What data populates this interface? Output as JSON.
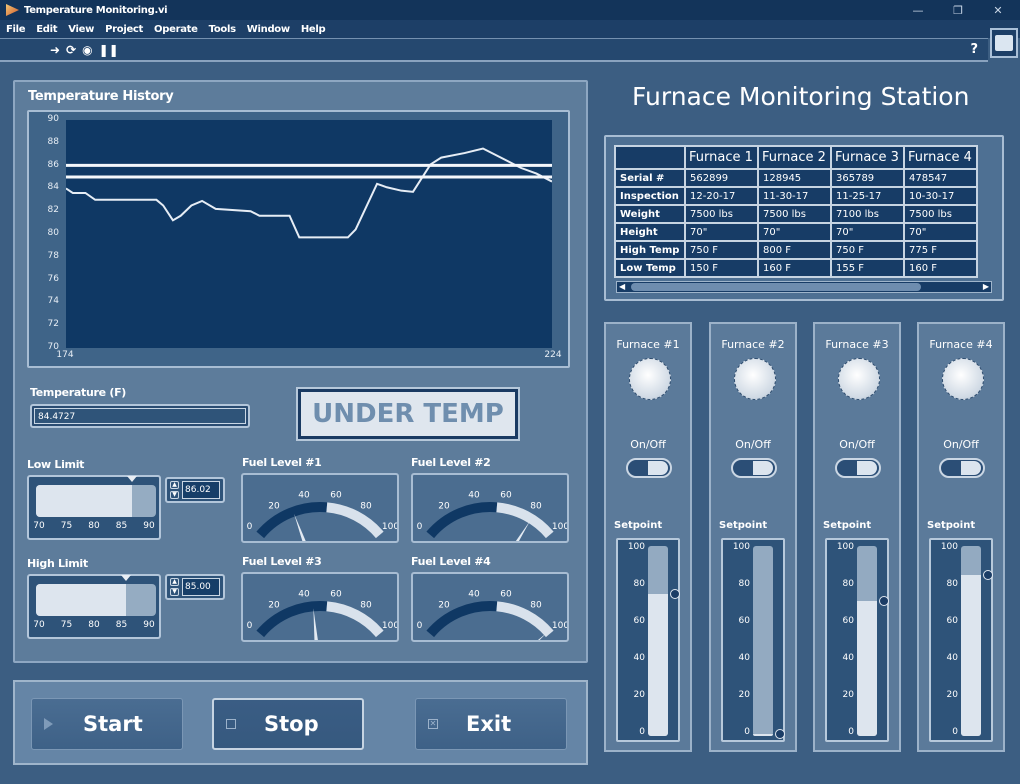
{
  "window": {
    "title": "Temperature Monitoring.vi",
    "controls": [
      "minimize",
      "restore",
      "close"
    ]
  },
  "menu": [
    "File",
    "Edit",
    "View",
    "Project",
    "Operate",
    "Tools",
    "Window",
    "Help"
  ],
  "toolbar": {
    "icons": [
      "run-arrow-icon",
      "run-continuous-icon",
      "abort-icon",
      "pause-icon"
    ],
    "help": "?"
  },
  "graph": {
    "title": "Temperature History"
  },
  "chart_data": {
    "type": "line",
    "title": "Temperature History",
    "xlim": [
      174,
      224
    ],
    "ylim": [
      70,
      90
    ],
    "x_ticks": [
      "174",
      "224"
    ],
    "y_ticks": [
      "70",
      "72",
      "74",
      "76",
      "78",
      "80",
      "82",
      "84",
      "86",
      "88",
      "90"
    ],
    "series": [
      {
        "name": "Temperature",
        "points": [
          [
            174,
            84.0
          ],
          [
            174.7,
            83.6
          ],
          [
            176,
            83.6
          ],
          [
            177,
            83.0
          ],
          [
            183.3,
            83.0
          ],
          [
            184,
            82.5
          ],
          [
            185,
            81.2
          ],
          [
            185.8,
            81.6
          ],
          [
            186.9,
            82.5
          ],
          [
            188,
            82.9
          ],
          [
            189.4,
            82.2
          ],
          [
            193,
            82.0
          ],
          [
            193.9,
            81.6
          ],
          [
            197,
            81.6
          ],
          [
            198,
            79.7
          ],
          [
            203,
            79.7
          ],
          [
            203.8,
            80.4
          ],
          [
            206,
            84.4
          ],
          [
            207,
            84.1
          ],
          [
            208.5,
            83.8
          ],
          [
            209.7,
            83.7
          ],
          [
            211.5,
            86.1
          ],
          [
            212.6,
            86.7
          ],
          [
            215,
            87.1
          ],
          [
            216.9,
            87.5
          ],
          [
            220.8,
            85.8
          ],
          [
            222.4,
            85.3
          ],
          [
            224,
            84.6
          ]
        ]
      },
      {
        "name": "Low Limit",
        "points": [
          [
            174,
            86.02
          ],
          [
            224,
            86.02
          ]
        ]
      },
      {
        "name": "High Limit",
        "points": [
          [
            174,
            85.0
          ],
          [
            224,
            85.0
          ]
        ]
      }
    ]
  },
  "temperature": {
    "label": "Temperature (F)",
    "value": "84.4727"
  },
  "status": {
    "text": "UNDER TEMP"
  },
  "low_limit": {
    "label": "Low Limit",
    "value": "86.02",
    "scale": [
      "70",
      "75",
      "80",
      "85",
      "90"
    ],
    "level": 86.02
  },
  "high_limit": {
    "label": "High Limit",
    "value": "85.00",
    "scale": [
      "70",
      "75",
      "80",
      "85",
      "90"
    ],
    "level": 85.0
  },
  "gauges": [
    {
      "label": "Fuel Level #1",
      "value": 30
    },
    {
      "label": "Fuel Level #2",
      "value": 82
    },
    {
      "label": "Fuel Level #3",
      "value": 45
    },
    {
      "label": "Fuel Level #4",
      "value": 98
    }
  ],
  "gauge_scale": [
    "0",
    "20",
    "40",
    "60",
    "80",
    "100"
  ],
  "station": {
    "title": "Furnace Monitoring Station"
  },
  "table": {
    "headers": [
      "",
      "Furnace 1",
      "Furnace 2",
      "Furnace 3",
      "Furnace 4"
    ],
    "rows": [
      [
        "Serial #",
        "562899",
        "128945",
        "365789",
        "478547"
      ],
      [
        "Inspection",
        "12-20-17",
        "11-30-17",
        "11-25-17",
        "10-30-17"
      ],
      [
        "Weight",
        "7500 lbs",
        "7500 lbs",
        "7100 lbs",
        "7500 lbs"
      ],
      [
        "Height",
        "70\"",
        "70\"",
        "70\"",
        "70\""
      ],
      [
        "High Temp",
        "750 F",
        "800 F",
        "750 F",
        "775 F"
      ],
      [
        "Low Temp",
        "150 F",
        "160 F",
        "155 F",
        "160 F"
      ]
    ]
  },
  "furnaces": [
    {
      "name": "Furnace #1",
      "onoff_label": "On/Off",
      "setpoint_label": "Setpoint",
      "setpoint": 75
    },
    {
      "name": "Furnace #2",
      "onoff_label": "On/Off",
      "setpoint_label": "Setpoint",
      "setpoint": 1
    },
    {
      "name": "Furnace #3",
      "onoff_label": "On/Off",
      "setpoint_label": "Setpoint",
      "setpoint": 71
    },
    {
      "name": "Furnace #4",
      "onoff_label": "On/Off",
      "setpoint_label": "Setpoint",
      "setpoint": 85
    }
  ],
  "setpoint_scale": [
    "100",
    "80",
    "60",
    "40",
    "20",
    "0"
  ],
  "buttons": {
    "start": "Start",
    "stop": "Stop",
    "exit": "Exit"
  }
}
